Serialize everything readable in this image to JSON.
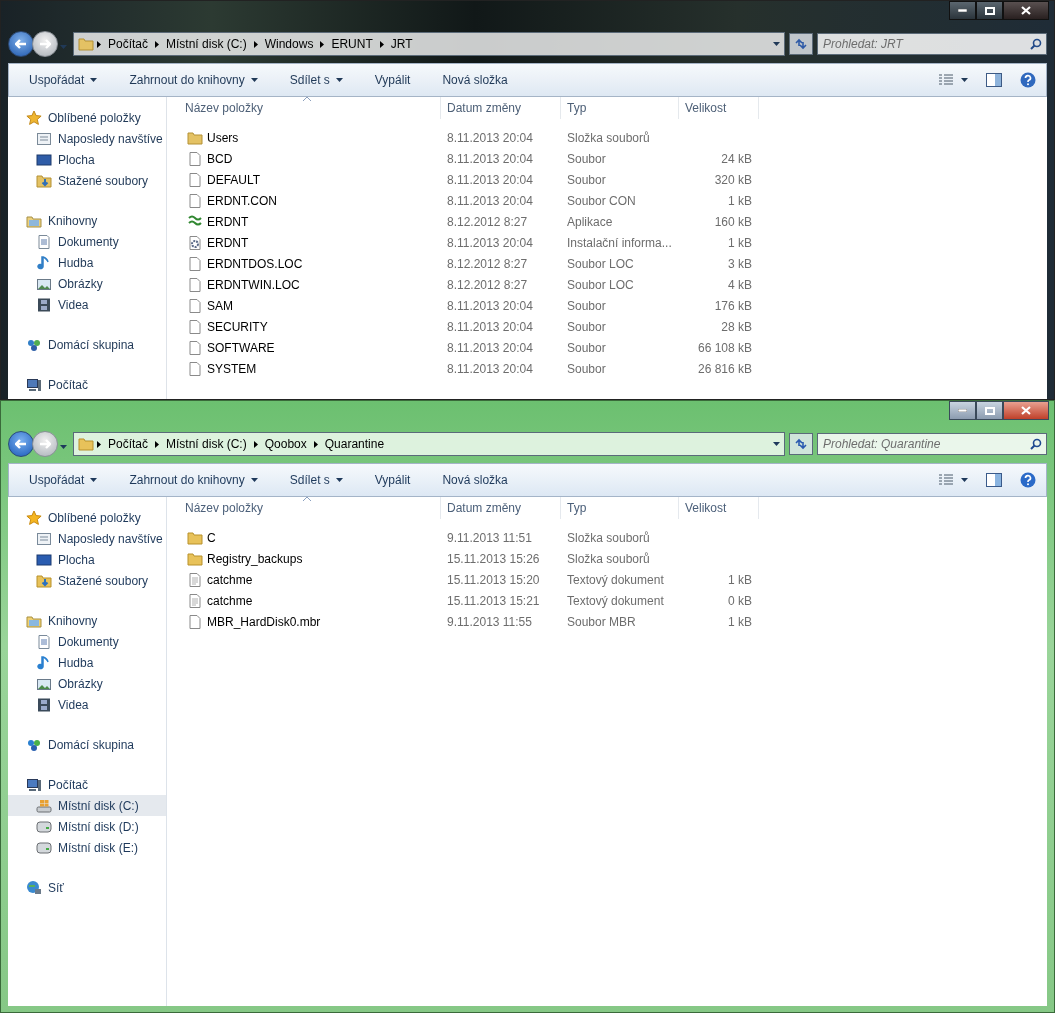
{
  "windows": [
    {
      "active": false,
      "breadcrumb": [
        "Počítač",
        "Místní disk (C:)",
        "Windows",
        "ERUNT",
        "JRT"
      ],
      "search": {
        "placeholder": "Prohledat: JRT"
      },
      "toolbar": [
        {
          "label": "Uspořádat",
          "menu": true
        },
        {
          "label": "Zahrnout do knihovny",
          "menu": true
        },
        {
          "label": "Sdílet s",
          "menu": true
        },
        {
          "label": "Vypálit",
          "menu": false
        },
        {
          "label": "Nová složka",
          "menu": false
        }
      ],
      "sidebar": [
        {
          "label": "Oblíbené položky",
          "kind": "favorites",
          "items": [
            {
              "label": "Naposledy navštíve",
              "kind": "recent",
              "selected": false
            },
            {
              "label": "Plocha",
              "kind": "desktop",
              "selected": false
            },
            {
              "label": "Stažené soubory",
              "kind": "downloads",
              "selected": false
            }
          ]
        },
        {
          "label": "Knihovny",
          "kind": "libraries",
          "items": [
            {
              "label": "Dokumenty",
              "kind": "documents",
              "selected": false
            },
            {
              "label": "Hudba",
              "kind": "music",
              "selected": false
            },
            {
              "label": "Obrázky",
              "kind": "pictures",
              "selected": false
            },
            {
              "label": "Videa",
              "kind": "videos",
              "selected": false
            }
          ]
        },
        {
          "label": "Domácí skupina",
          "kind": "homegroup"
        },
        {
          "label": "Počítač",
          "kind": "computer"
        }
      ],
      "columns": [
        "Název položky",
        "Datum změny",
        "Typ",
        "Velikost"
      ],
      "rows": [
        {
          "kind": "folder",
          "name": "Users",
          "date": "8.11.2013 20:04",
          "type": "Složka souborů",
          "size": ""
        },
        {
          "kind": "file",
          "name": "BCD",
          "date": "8.11.2013 20:04",
          "type": "Soubor",
          "size": "24 kB"
        },
        {
          "kind": "file",
          "name": "DEFAULT",
          "date": "8.11.2013 20:04",
          "type": "Soubor",
          "size": "320 kB"
        },
        {
          "kind": "file",
          "name": "ERDNT.CON",
          "date": "8.11.2013 20:04",
          "type": "Soubor CON",
          "size": "1 kB"
        },
        {
          "kind": "app",
          "name": "ERDNT",
          "date": "8.12.2012 8:27",
          "type": "Aplikace",
          "size": "160 kB"
        },
        {
          "kind": "setup",
          "name": "ERDNT",
          "date": "8.11.2013 20:04",
          "type": "Instalační informa...",
          "size": "1 kB"
        },
        {
          "kind": "file",
          "name": "ERDNTDOS.LOC",
          "date": "8.12.2012 8:27",
          "type": "Soubor LOC",
          "size": "3 kB"
        },
        {
          "kind": "file",
          "name": "ERDNTWIN.LOC",
          "date": "8.12.2012 8:27",
          "type": "Soubor LOC",
          "size": "4 kB"
        },
        {
          "kind": "file",
          "name": "SAM",
          "date": "8.11.2013 20:04",
          "type": "Soubor",
          "size": "176 kB"
        },
        {
          "kind": "file",
          "name": "SECURITY",
          "date": "8.11.2013 20:04",
          "type": "Soubor",
          "size": "28 kB"
        },
        {
          "kind": "file",
          "name": "SOFTWARE",
          "date": "8.11.2013 20:04",
          "type": "Soubor",
          "size": "66 108 kB"
        },
        {
          "kind": "file",
          "name": "SYSTEM",
          "date": "8.11.2013 20:04",
          "type": "Soubor",
          "size": "26 816 kB"
        }
      ]
    },
    {
      "active": true,
      "breadcrumb": [
        "Počítač",
        "Místní disk (C:)",
        "Qoobox",
        "Quarantine"
      ],
      "search": {
        "placeholder": "Prohledat: Quarantine"
      },
      "toolbar": [
        {
          "label": "Uspořádat",
          "menu": true
        },
        {
          "label": "Zahrnout do knihovny",
          "menu": true
        },
        {
          "label": "Sdílet s",
          "menu": true
        },
        {
          "label": "Vypálit",
          "menu": false
        },
        {
          "label": "Nová složka",
          "menu": false
        }
      ],
      "sidebar": [
        {
          "label": "Oblíbené položky",
          "kind": "favorites",
          "items": [
            {
              "label": "Naposledy navštíve",
              "kind": "recent",
              "selected": false
            },
            {
              "label": "Plocha",
              "kind": "desktop",
              "selected": false
            },
            {
              "label": "Stažené soubory",
              "kind": "downloads",
              "selected": false
            }
          ]
        },
        {
          "label": "Knihovny",
          "kind": "libraries",
          "items": [
            {
              "label": "Dokumenty",
              "kind": "documents",
              "selected": false
            },
            {
              "label": "Hudba",
              "kind": "music",
              "selected": false
            },
            {
              "label": "Obrázky",
              "kind": "pictures",
              "selected": false
            },
            {
              "label": "Videa",
              "kind": "videos",
              "selected": false
            }
          ]
        },
        {
          "label": "Domácí skupina",
          "kind": "homegroup"
        },
        {
          "label": "Počítač",
          "kind": "computer",
          "items": [
            {
              "label": "Místní disk (C:)",
              "kind": "system-drive",
              "selected": true
            },
            {
              "label": "Místní disk (D:)",
              "kind": "drive",
              "selected": false
            },
            {
              "label": "Místní disk (E:)",
              "kind": "drive",
              "selected": false
            }
          ]
        },
        {
          "label": "Síť",
          "kind": "network"
        }
      ],
      "columns": [
        "Název položky",
        "Datum změny",
        "Typ",
        "Velikost"
      ],
      "rows": [
        {
          "kind": "folder",
          "name": "C",
          "date": "9.11.2013 11:51",
          "type": "Složka souborů",
          "size": ""
        },
        {
          "kind": "folder",
          "name": "Registry_backups",
          "date": "15.11.2013 15:26",
          "type": "Složka souborů",
          "size": ""
        },
        {
          "kind": "text",
          "name": "catchme",
          "date": "15.11.2013 15:20",
          "type": "Textový dokument",
          "size": "1 kB"
        },
        {
          "kind": "text",
          "name": "catchme",
          "date": "15.11.2013 15:21",
          "type": "Textový dokument",
          "size": "0 kB"
        },
        {
          "kind": "file",
          "name": "MBR_HardDisk0.mbr",
          "date": "9.11.2013 11:55",
          "type": "Soubor MBR",
          "size": "1 kB"
        }
      ]
    }
  ]
}
